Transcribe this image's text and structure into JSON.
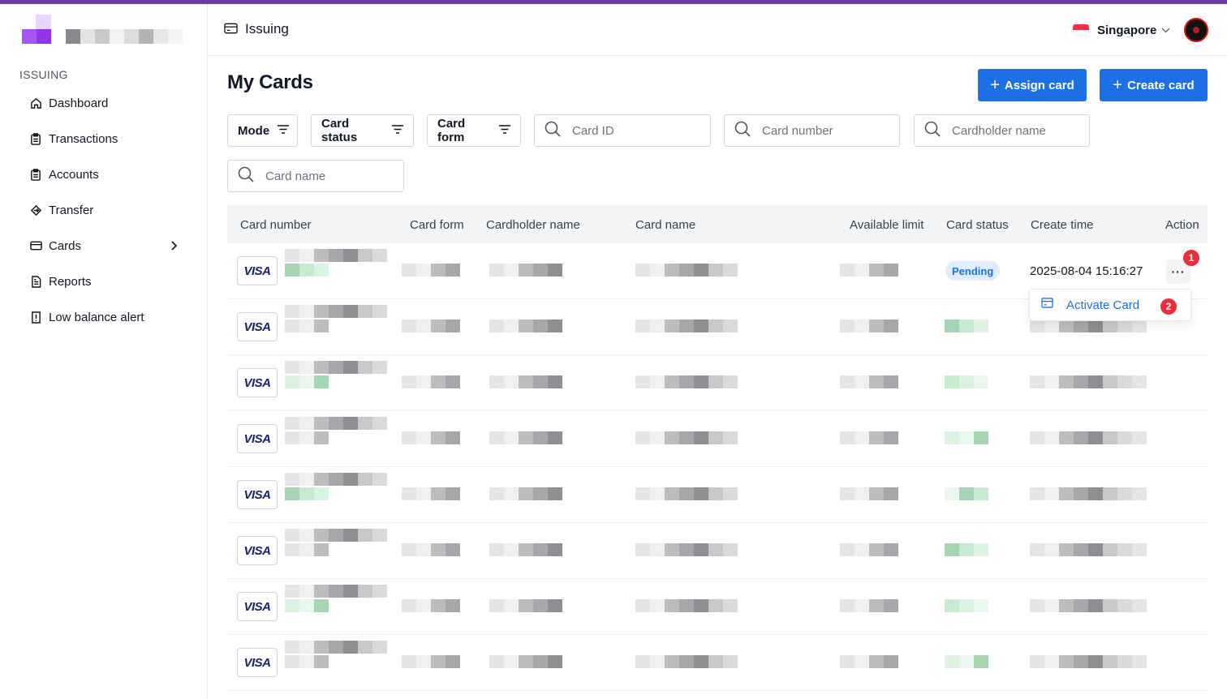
{
  "sidebar": {
    "section": "ISSUING",
    "items": [
      {
        "label": "Dashboard",
        "icon": "home-icon"
      },
      {
        "label": "Transactions",
        "icon": "clipboard-icon"
      },
      {
        "label": "Accounts",
        "icon": "clipboard-icon"
      },
      {
        "label": "Transfer",
        "icon": "transfer-icon"
      },
      {
        "label": "Cards",
        "icon": "card-icon",
        "has_submenu": true
      },
      {
        "label": "Reports",
        "icon": "document-icon"
      },
      {
        "label": "Low balance alert",
        "icon": "alert-icon"
      }
    ]
  },
  "header": {
    "breadcrumb": "Issuing",
    "country": "Singapore"
  },
  "main": {
    "title": "My Cards",
    "buttons": {
      "assign": "Assign card",
      "create": "Create card"
    },
    "filters": {
      "mode": "Mode",
      "card_status": "Card status",
      "card_form": "Card form"
    },
    "search": {
      "card_id": "Card ID",
      "card_number": "Card number",
      "cardholder_name": "Cardholder name",
      "card_name": "Card name"
    },
    "table": {
      "columns": [
        "Card number",
        "Card form",
        "Cardholder name",
        "Card name",
        "Available limit",
        "Card status",
        "Create time",
        "Action"
      ],
      "brand": "VISA",
      "first_row": {
        "status": "Pending",
        "create_time": "2025-08-04 15:16:27"
      }
    },
    "action_menu": {
      "item": "Activate Card"
    },
    "badges": {
      "one": "1",
      "two": "2"
    }
  },
  "colors": {
    "accent": "#1d6fe5",
    "brand_purple": "#9333ea",
    "badge_red": "#ef2d3a",
    "pending_bg": "#e0ecff"
  }
}
